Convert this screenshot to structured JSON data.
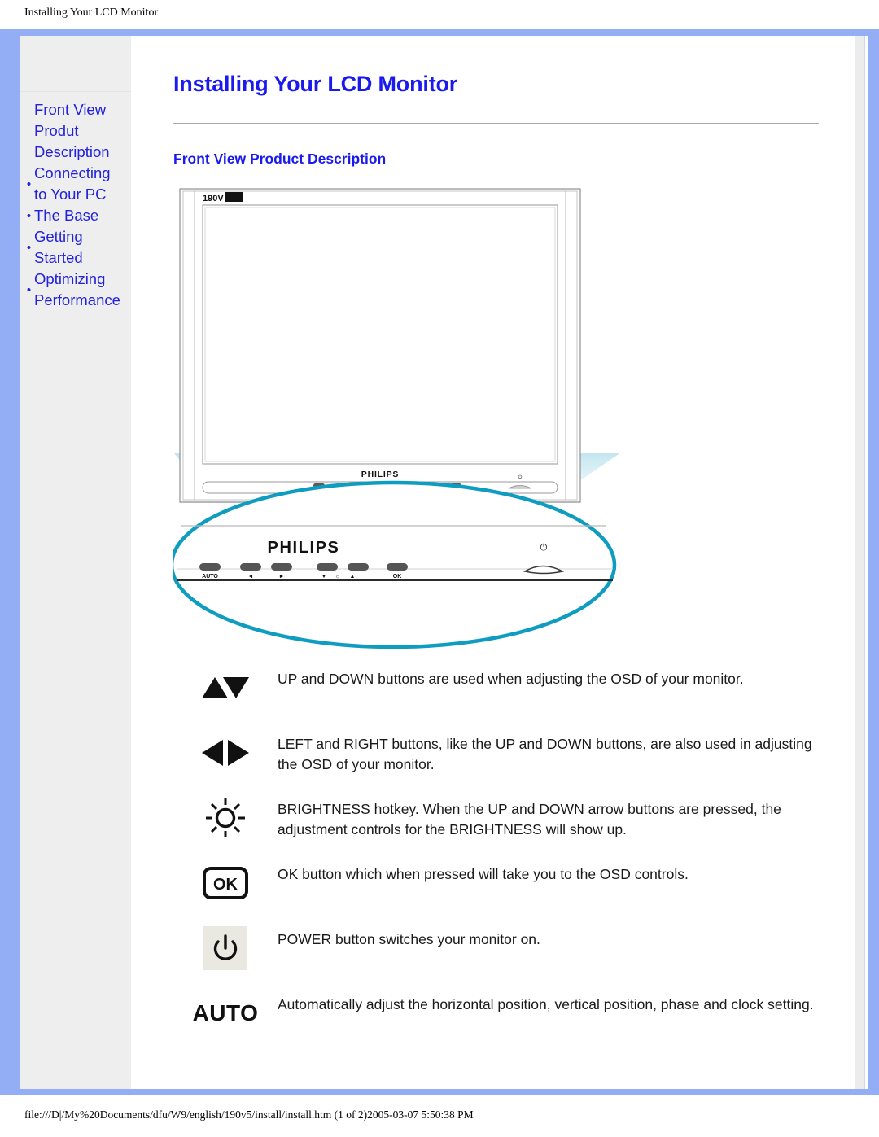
{
  "page_header": "Installing Your LCD Monitor",
  "footer": {
    "path": "file:///D|/My%20Documents/dfu/W9/english/190v5/install/install.htm (1 of 2)2005-03-07 5:50:38 PM"
  },
  "colors": {
    "frame": "#93aef4",
    "sidebar_bg": "#eeeeee",
    "link": "#2222dd",
    "heading": "#1a1aee",
    "callout": "#0e9cc0",
    "beam": "#cfeaf2"
  },
  "sidebar": {
    "items": [
      {
        "label": "Front View\nProdut\nDescription",
        "bullet": true,
        "bullet_visible": false
      },
      {
        "label": "Connecting\nto Your PC",
        "bullet": true,
        "bullet_visible": true
      },
      {
        "label": "The Base",
        "bullet": true,
        "bullet_visible": true
      },
      {
        "label": "Getting\nStarted",
        "bullet": true,
        "bullet_visible": true
      },
      {
        "label": "Optimizing\nPerformance",
        "bullet": true,
        "bullet_visible": true
      }
    ],
    "bullet_glyph": "•"
  },
  "main": {
    "title": "Installing Your LCD Monitor",
    "section_title": "Front View Product Description"
  },
  "figure": {
    "brand": "PHILIPS",
    "model_badge": "190V",
    "bezel_buttons": [
      {
        "label": "AUTO"
      },
      {
        "label": "◄"
      },
      {
        "label": "►"
      },
      {
        "label": "▼"
      },
      {
        "label": "☼"
      },
      {
        "label": "▲"
      },
      {
        "label": "OK"
      }
    ],
    "power_mark": "⏻"
  },
  "descriptions": [
    {
      "icon": "up-down-arrows-icon",
      "glyph": "",
      "text": "UP and DOWN buttons are used when adjusting the OSD of your monitor."
    },
    {
      "icon": "left-right-arrows-icon",
      "glyph": "",
      "text": "LEFT and RIGHT buttons, like the UP and DOWN buttons, are also used in adjusting the OSD of your monitor."
    },
    {
      "icon": "brightness-sun-icon",
      "glyph": "",
      "text": "BRIGHTNESS hotkey. When the UP and DOWN arrow buttons are pressed, the adjustment controls for the BRIGHTNESS will show up."
    },
    {
      "icon": "ok-button-icon",
      "glyph": "OK",
      "text": "OK button which when pressed will take you to the OSD controls."
    },
    {
      "icon": "power-button-icon",
      "glyph": "",
      "text": "POWER button switches your monitor on."
    },
    {
      "icon": "auto-button-icon",
      "glyph": "AUTO",
      "text": "Automatically adjust the horizontal position, vertical position, phase and clock setting."
    }
  ]
}
